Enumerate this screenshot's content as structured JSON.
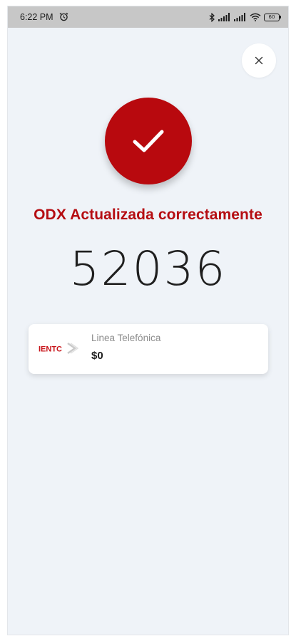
{
  "status_bar": {
    "time": "6:22 PM",
    "battery": "60"
  },
  "icons": {
    "alarm": "alarm-clock-icon",
    "bluetooth": "bluetooth-icon",
    "signal": "signal-icon",
    "wifi": "wifi-icon",
    "battery": "battery-icon",
    "close": "close-icon",
    "check": "checkmark-icon"
  },
  "colors": {
    "accent": "#b8090e",
    "background": "#eff3f8"
  },
  "main": {
    "title": "ODX Actualizada correctamente",
    "odx_number": "52036"
  },
  "card": {
    "logo_text": "IENTC",
    "title": "Linea Telefónica",
    "amount": "$0"
  }
}
